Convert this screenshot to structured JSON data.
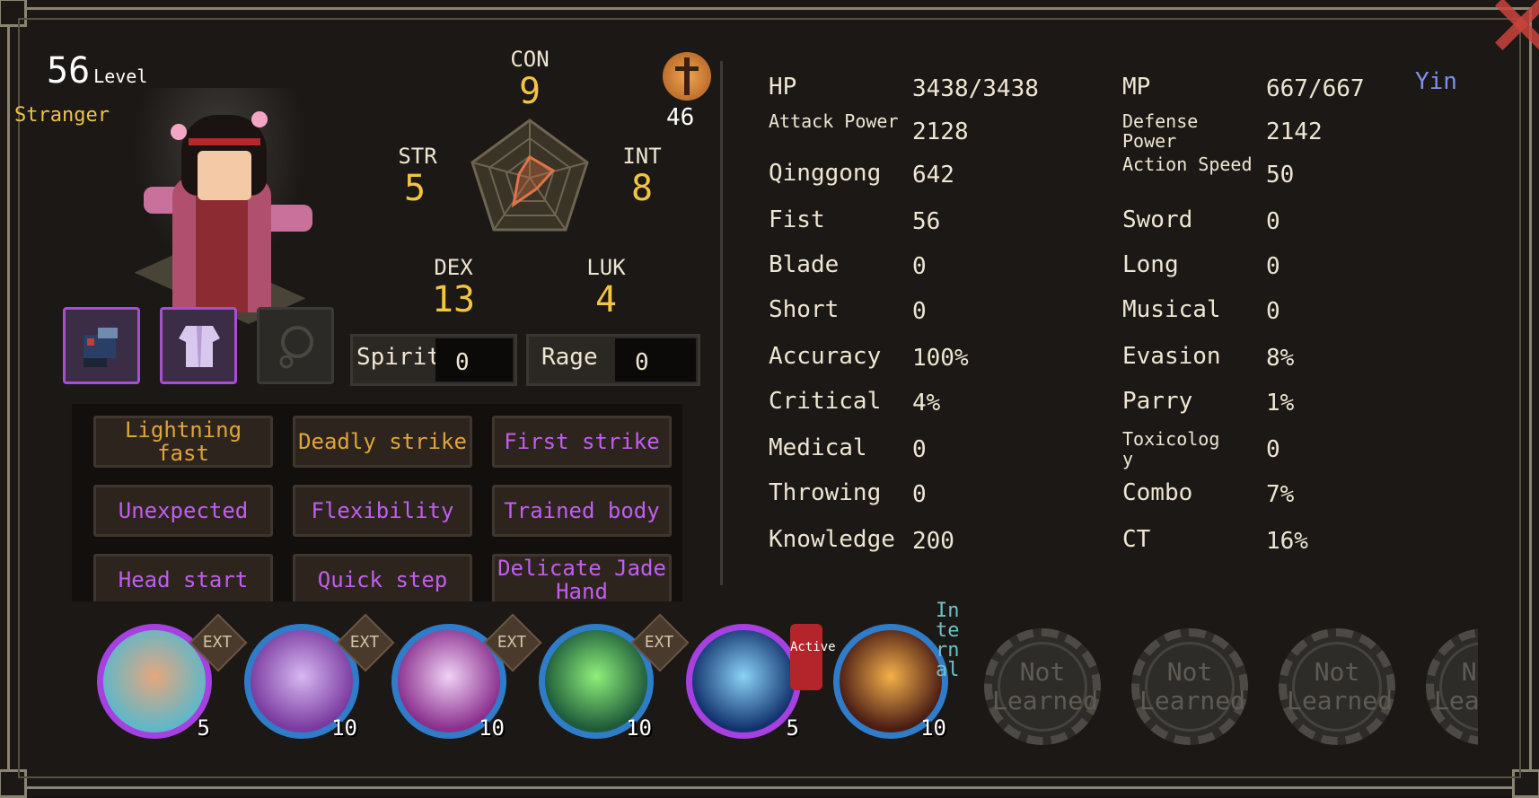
{
  "character": {
    "level_value": "56",
    "level_label": "Level",
    "title": "Stranger"
  },
  "stats": {
    "con": {
      "label": "CON",
      "value": "9"
    },
    "str": {
      "label": "STR",
      "value": "5"
    },
    "int": {
      "label": "INT",
      "value": "8"
    },
    "dex": {
      "label": "DEX",
      "value": "13"
    },
    "luk": {
      "label": "LUK",
      "value": "4"
    }
  },
  "badge": {
    "icon": "sword-sun-icon",
    "value": "46"
  },
  "equipment": [
    {
      "icon": "gauntlet-icon",
      "state": "equipped"
    },
    {
      "icon": "robe-icon",
      "state": "equipped"
    },
    {
      "icon": "amulet-icon",
      "state": "empty"
    }
  ],
  "resources": {
    "spirit": {
      "label": "Spirit",
      "value": "0"
    },
    "rage": {
      "label": "Rage",
      "value": "0"
    }
  },
  "traits": [
    {
      "label": "Lightning fast",
      "color": "#e0a43a"
    },
    {
      "label": "Deadly strike",
      "color": "#e0a43a"
    },
    {
      "label": "First strike",
      "color": "#c25df0"
    },
    {
      "label": "Unexpected",
      "color": "#c25df0"
    },
    {
      "label": "Flexibility",
      "color": "#c25df0"
    },
    {
      "label": "Trained body",
      "color": "#c25df0"
    },
    {
      "label": "Head start",
      "color": "#c25df0"
    },
    {
      "label": "Quick step",
      "color": "#c25df0"
    },
    {
      "label": "Delicate Jade Hand",
      "color": "#c25df0"
    }
  ],
  "attributes": {
    "left": [
      {
        "label": "HP",
        "value": "3438/3438"
      },
      {
        "label": "Attack Power",
        "value": "2128"
      },
      {
        "label": "Qinggong",
        "value": "642"
      },
      {
        "label": "Fist",
        "value": "56"
      },
      {
        "label": "Blade",
        "value": "0"
      },
      {
        "label": "Short",
        "value": "0"
      },
      {
        "label": "Accuracy",
        "value": "100%"
      },
      {
        "label": "Critical",
        "value": "4%"
      },
      {
        "label": "Medical",
        "value": "0"
      },
      {
        "label": "Throwing",
        "value": "0"
      },
      {
        "label": "Knowledge",
        "value": "200"
      }
    ],
    "right": [
      {
        "label": "MP",
        "value": "667/667"
      },
      {
        "label": "Defense Power",
        "value": "2142"
      },
      {
        "label": "Action Speed",
        "value": "50"
      },
      {
        "label": "Sword",
        "value": "0"
      },
      {
        "label": "Long",
        "value": "0"
      },
      {
        "label": "Musical",
        "value": "0"
      },
      {
        "label": "Evasion",
        "value": "8%"
      },
      {
        "label": "Parry",
        "value": "1%"
      },
      {
        "label": "Toxicology",
        "value": "0"
      },
      {
        "label": "Combo",
        "value": "7%"
      },
      {
        "label": "CT",
        "value": "16%"
      }
    ],
    "affinity": "Yin"
  },
  "skills": [
    {
      "icon": "finger-strike-icon",
      "count": "5",
      "tag": "EXT",
      "ring": "#a640e0",
      "colors": [
        "#5fb7c9",
        "#e6a77d"
      ]
    },
    {
      "icon": "glowing-palm-icon",
      "count": "10",
      "tag": "EXT",
      "ring": "#2f7cc8",
      "colors": [
        "#7a3aa0",
        "#d7b8f2"
      ]
    },
    {
      "icon": "sparkling-palm-icon",
      "count": "10",
      "tag": "EXT",
      "ring": "#2f7cc8",
      "colors": [
        "#8a2f8e",
        "#f0d2f5"
      ]
    },
    {
      "icon": "jade-orb-palm-icon",
      "count": "10",
      "tag": "EXT",
      "ring": "#2f7cc8",
      "colors": [
        "#1d5a3a",
        "#8ff07a"
      ]
    },
    {
      "icon": "blue-flame-icon",
      "count": "5",
      "tag": "Active",
      "ring": "#a640e0",
      "colors": [
        "#12326e",
        "#8ad2f5"
      ]
    },
    {
      "icon": "explosion-icon",
      "count": "10",
      "tag": "Internal",
      "ring": "#2f7cc8",
      "colors": [
        "#4a1c14",
        "#f5b04a"
      ]
    }
  ],
  "empty_slots": [
    "Not Learned",
    "Not Learned",
    "Not Learned",
    "Not Learned"
  ]
}
